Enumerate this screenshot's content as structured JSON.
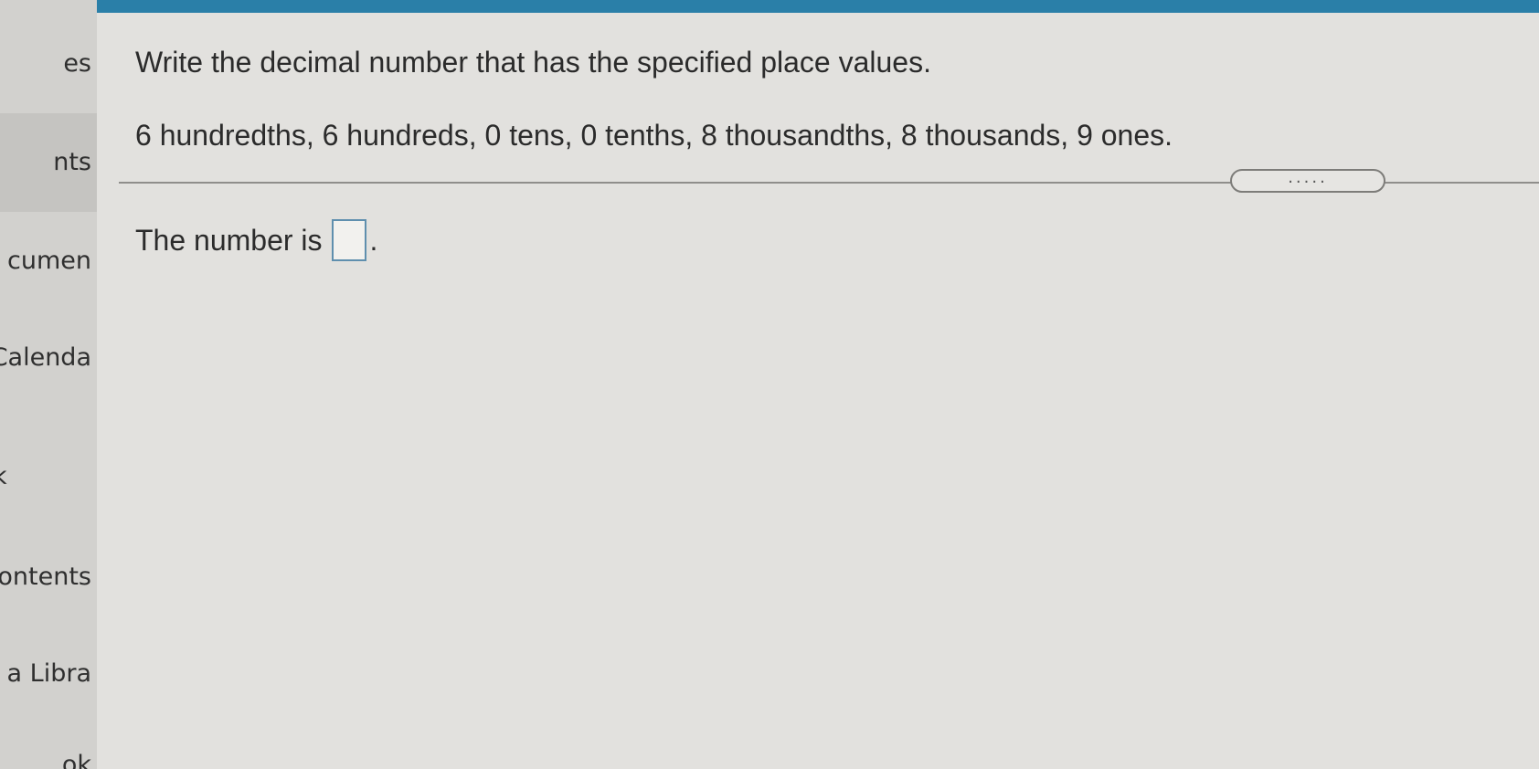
{
  "sidebar": {
    "items": [
      {
        "label": "es"
      },
      {
        "label": "nts"
      },
      {
        "label": "cumen"
      },
      {
        "label": "Calenda"
      },
      {
        "label": "k"
      },
      {
        "label": "ontents"
      },
      {
        "label": "a Libra"
      },
      {
        "label": "ok"
      }
    ]
  },
  "question": {
    "instruction": "Write the decimal number that has the specified place values.",
    "place_values": "6 hundredths, 6 hundreds, 0 tens, 0 tenths, 8 thousandths, 8 thousands, 9 ones.",
    "expand_handle": ".....",
    "answer_prefix": "The number is",
    "answer_value": "",
    "answer_suffix": "."
  },
  "colors": {
    "top_bar": "#2a7fa8",
    "input_border": "#5f8fae"
  }
}
